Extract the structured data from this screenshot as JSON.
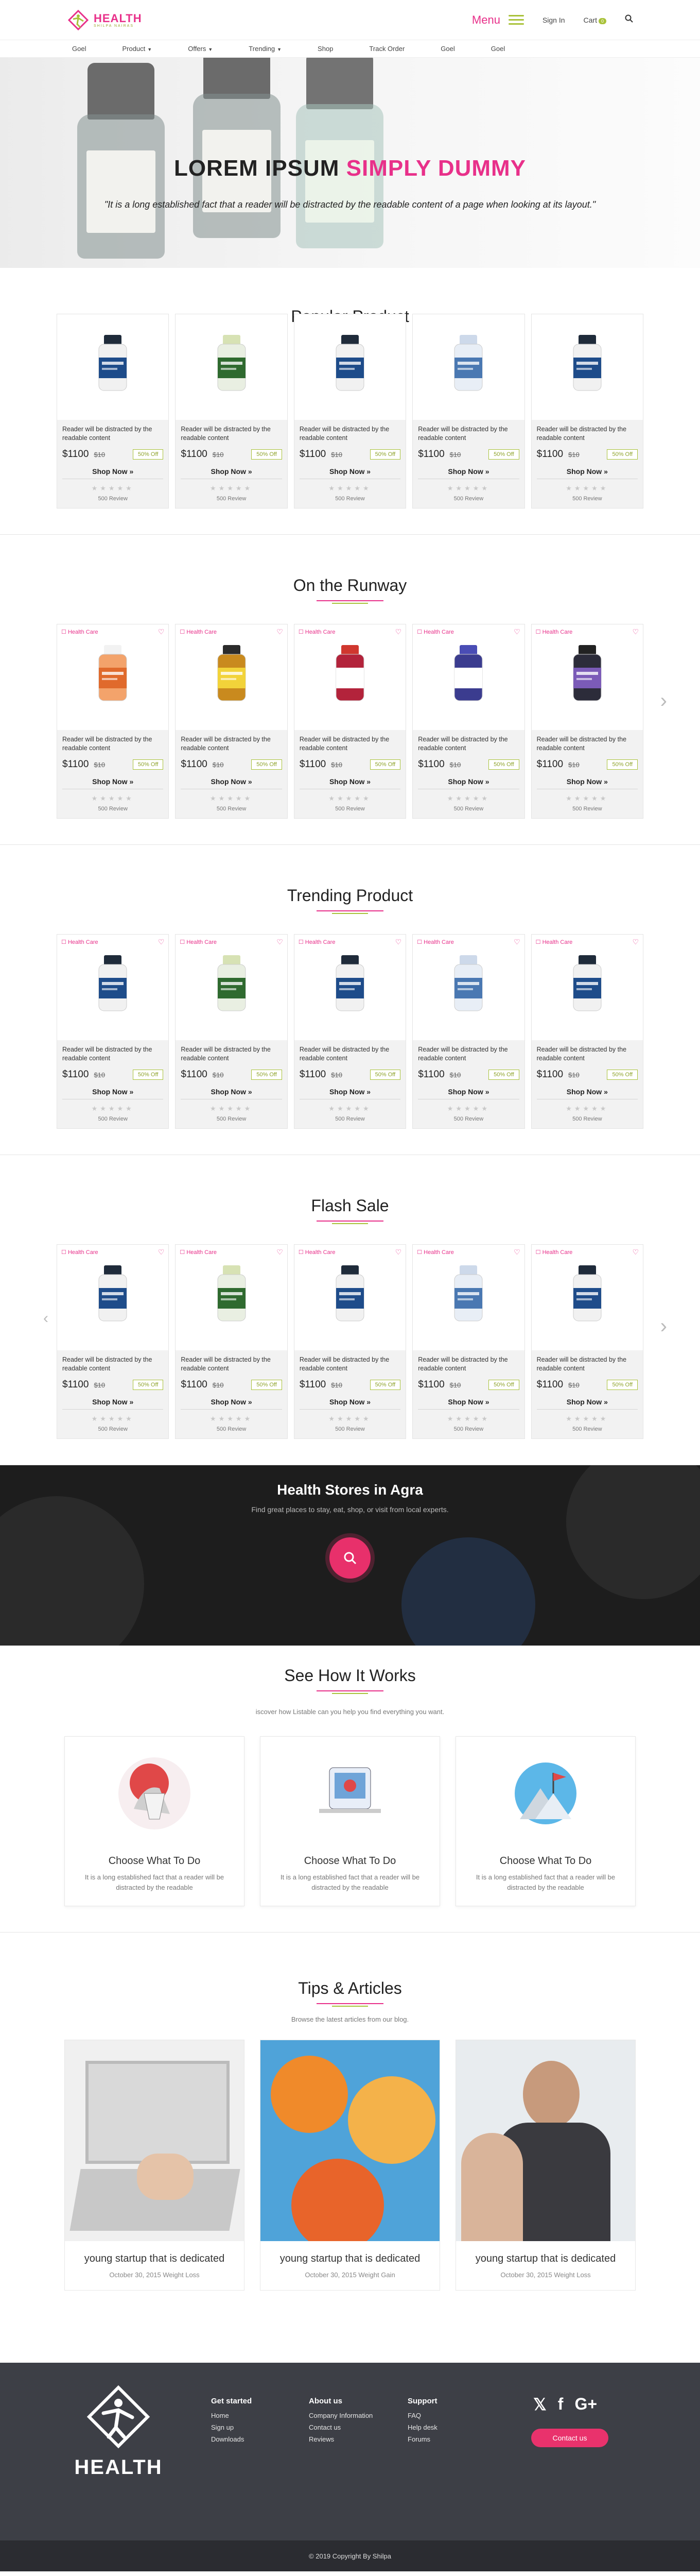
{
  "header": {
    "logo_text": "HEALTH",
    "logo_sub": "SHILPA NAIRAS",
    "menu_label": "Menu",
    "signin": "Sign In",
    "cart": "Cart",
    "cart_count": "0"
  },
  "nav": [
    {
      "label": "Goel",
      "caret": false
    },
    {
      "label": "Product",
      "caret": true
    },
    {
      "label": "Offers",
      "caret": true
    },
    {
      "label": "Trending",
      "caret": true
    },
    {
      "label": "Shop",
      "caret": false
    },
    {
      "label": "Track Order",
      "caret": false
    },
    {
      "label": "Goel",
      "caret": false
    },
    {
      "label": "Goel",
      "caret": false
    }
  ],
  "hero": {
    "title_a": "LOREM IPSUM",
    "title_b": "SIMPLY DUMMY",
    "subtitle": "\"It is a long established fact that a reader will be distracted by the readable content of a page when looking at its layout.\"",
    "slides": 3,
    "active_slide": 1
  },
  "product_common": {
    "desc": "Reader will be distracted by the readable content",
    "price": "$1100",
    "old_price": "$10",
    "off": "50% Off",
    "shop": "Shop Now",
    "reviews": "500 Review",
    "tag": "Health Care"
  },
  "sections": [
    {
      "title": "Popular Product",
      "tags": false,
      "arrows": false
    },
    {
      "title": "On the Runway",
      "tags": true,
      "arrows": true
    },
    {
      "title": "Trending Product",
      "tags": true,
      "arrows": false
    },
    {
      "title": "Flash Sale",
      "tags": true,
      "arrows": true
    }
  ],
  "stores": {
    "title": "Health Stores in Agra",
    "subtitle": "Find great places to stay, eat, shop, or visit from local experts."
  },
  "how": {
    "title": "See How It Works",
    "subtitle": "iscover how Listable can you help you find everything you want.",
    "cards": [
      {
        "title": "Choose What To Do",
        "text": "It is a long established fact that a reader will be distracted by the readable"
      },
      {
        "title": "Choose What To Do",
        "text": "It is a long established fact that a reader will be distracted by the readable"
      },
      {
        "title": "Choose What To Do",
        "text": "It is a long established fact that a reader will be distracted by the readable"
      }
    ]
  },
  "tips": {
    "title": "Tips & Articles",
    "subtitle": "Browse the latest articles from our blog.",
    "cards": [
      {
        "title": "young startup that is dedicated",
        "meta": "October 30, 2015 Weight Loss"
      },
      {
        "title": "young startup that is dedicated",
        "meta": "October 30, 2015 Weight Gain"
      },
      {
        "title": "young startup that is dedicated",
        "meta": "October 30, 2015 Weight Loss"
      }
    ]
  },
  "footer": {
    "logo_text": "HEALTH",
    "cols": [
      {
        "title": "Get started",
        "links": [
          "Home",
          "Sign up",
          "Downloads"
        ]
      },
      {
        "title": "About us",
        "links": [
          "Company Information",
          "Contact us",
          "Reviews"
        ]
      },
      {
        "title": "Support",
        "links": [
          "FAQ",
          "Help desk",
          "Forums"
        ]
      }
    ],
    "social": [
      "twitter-icon",
      "facebook-icon",
      "google-plus-icon"
    ],
    "contact_label": "Contact us",
    "copyright": "© 2019 Copyright By Shilpa"
  },
  "colors": {
    "pink": "#e8308a",
    "green": "#a9c23a",
    "footer_bg": "#3d3f46"
  }
}
